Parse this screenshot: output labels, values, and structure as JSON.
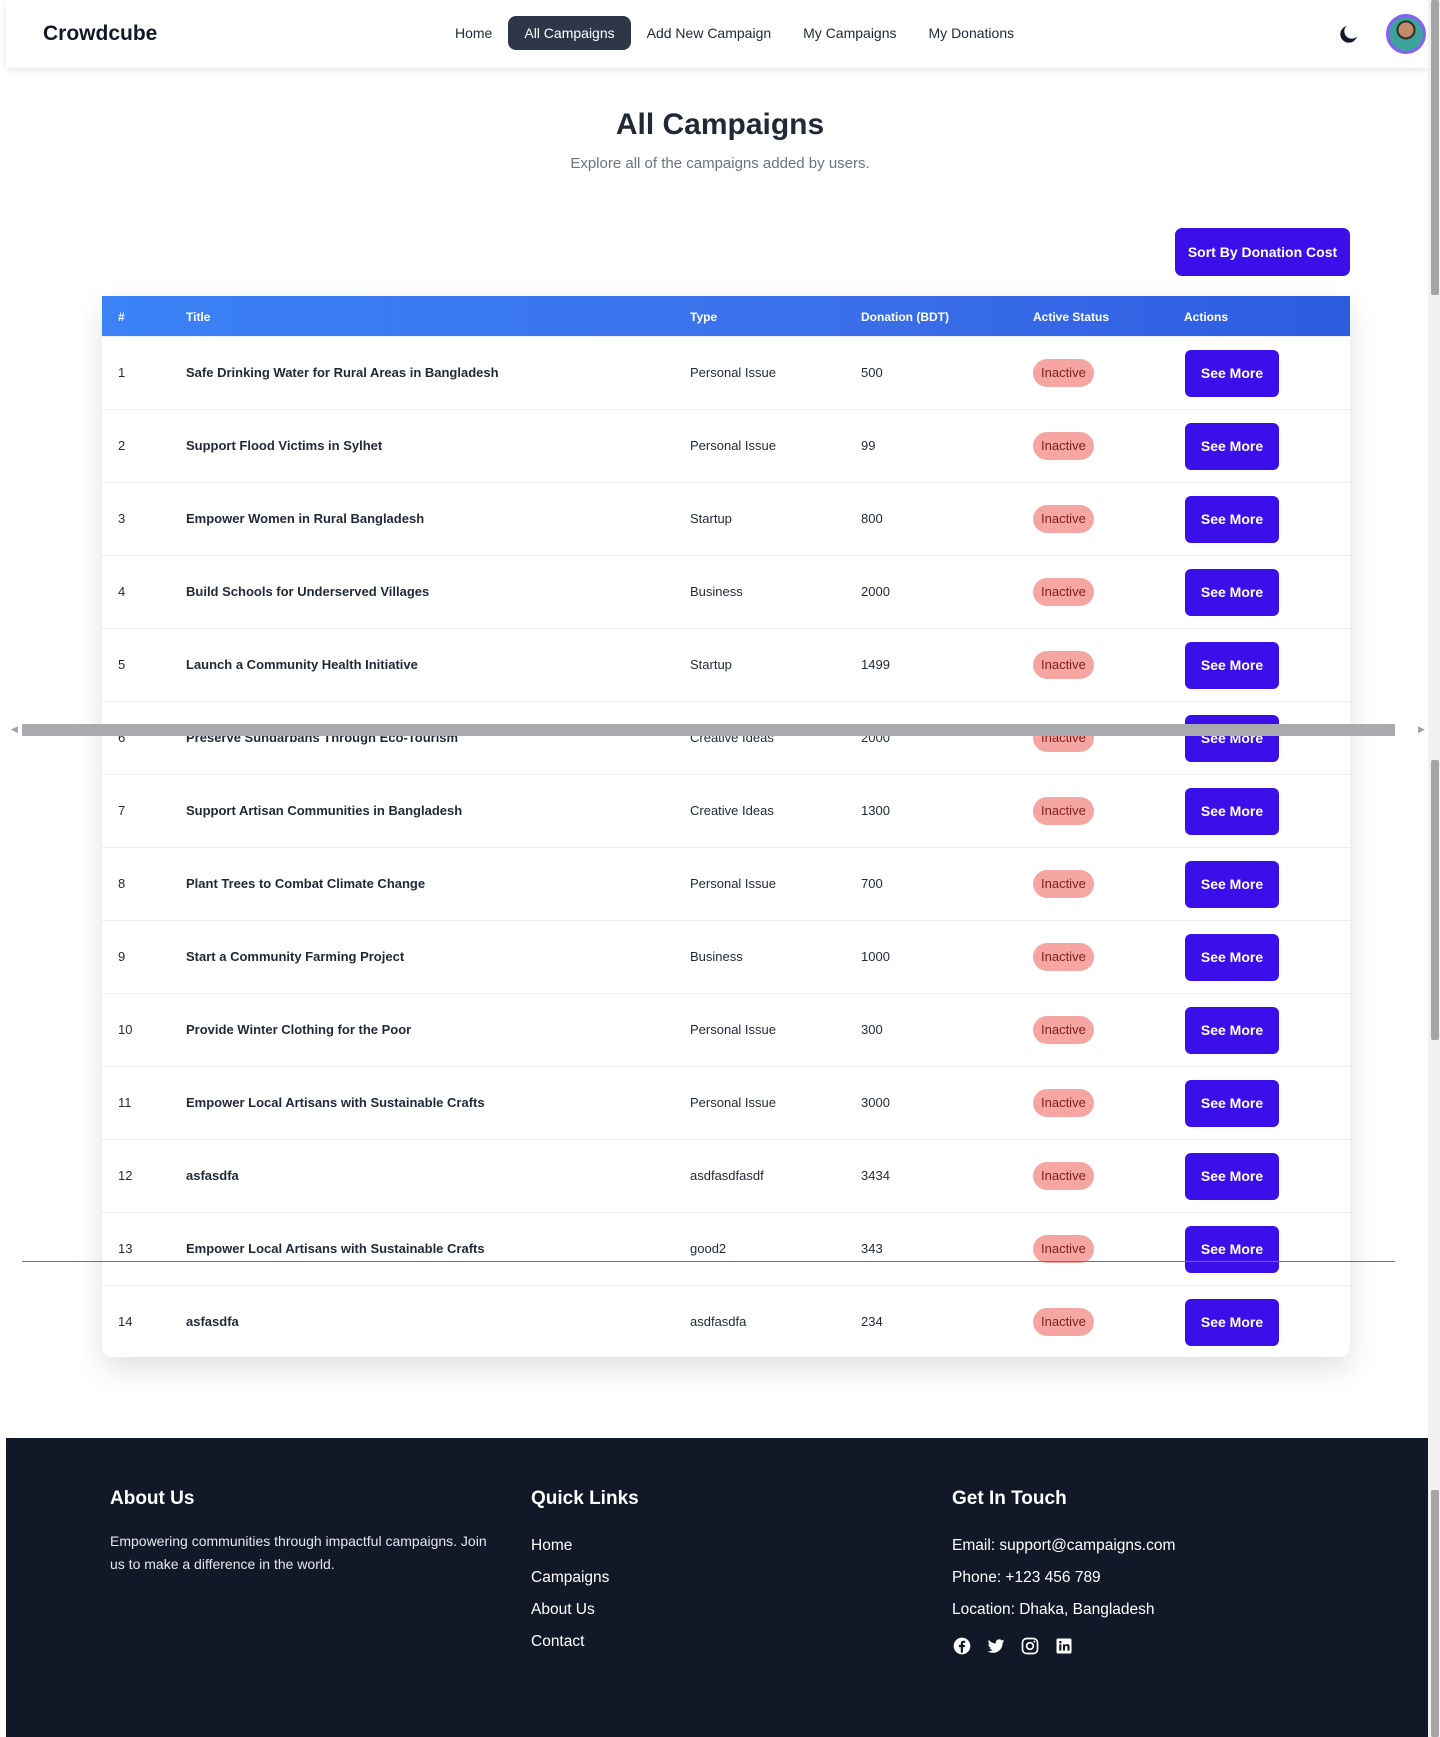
{
  "nav": {
    "brand": "Crowdcube",
    "links": [
      "Home",
      "All Campaigns",
      "Add New Campaign",
      "My Campaigns",
      "My Donations"
    ],
    "active": "All Campaigns",
    "theme_icon": "moon-icon",
    "avatar_icon": "user-avatar"
  },
  "hero": {
    "title": "All Campaigns",
    "subtitle": "Explore all of the campaigns added by users."
  },
  "sort_button": "Sort By Donation Cost",
  "table": {
    "headers": [
      "#",
      "Title",
      "Type",
      "Donation (BDT)",
      "Active Status",
      "Actions"
    ],
    "rows": [
      {
        "num": "1",
        "title": "Safe Drinking Water for Rural Areas in Bangladesh",
        "type": "Personal Issue",
        "donation": "500",
        "status": "Inactive",
        "action": "See More"
      },
      {
        "num": "2",
        "title": "Support Flood Victims in Sylhet",
        "type": "Personal Issue",
        "donation": "99",
        "status": "Inactive",
        "action": "See More"
      },
      {
        "num": "3",
        "title": "Empower Women in Rural Bangladesh",
        "type": "Startup",
        "donation": "800",
        "status": "Inactive",
        "action": "See More"
      },
      {
        "num": "4",
        "title": "Build Schools for Underserved Villages",
        "type": "Business",
        "donation": "2000",
        "status": "Inactive",
        "action": "See More"
      },
      {
        "num": "5",
        "title": "Launch a Community Health Initiative",
        "type": "Startup",
        "donation": "1499",
        "status": "Inactive",
        "action": "See More"
      },
      {
        "num": "6",
        "title": "Preserve Sundarbans Through Eco-Tourism",
        "type": "Creative Ideas",
        "donation": "2000",
        "status": "Inactive",
        "action": "See More"
      },
      {
        "num": "7",
        "title": "Support Artisan Communities in Bangladesh",
        "type": "Creative Ideas",
        "donation": "1300",
        "status": "Inactive",
        "action": "See More"
      },
      {
        "num": "8",
        "title": "Plant Trees to Combat Climate Change",
        "type": "Personal Issue",
        "donation": "700",
        "status": "Inactive",
        "action": "See More"
      },
      {
        "num": "9",
        "title": "Start a Community Farming Project",
        "type": "Business",
        "donation": "1000",
        "status": "Inactive",
        "action": "See More"
      },
      {
        "num": "10",
        "title": "Provide Winter Clothing for the Poor",
        "type": "Personal Issue",
        "donation": "300",
        "status": "Inactive",
        "action": "See More"
      },
      {
        "num": "11",
        "title": "Empower Local Artisans with Sustainable Crafts",
        "type": "Personal Issue",
        "donation": "3000",
        "status": "Inactive",
        "action": "See More"
      },
      {
        "num": "12",
        "title": "asfasdfa",
        "type": "asdfasdfasdf",
        "donation": "3434",
        "status": "Inactive",
        "action": "See More"
      },
      {
        "num": "13",
        "title": "Empower Local Artisans with Sustainable Crafts",
        "type": "good2",
        "donation": "343",
        "status": "Inactive",
        "action": "See More"
      },
      {
        "num": "14",
        "title": "asfasdfa",
        "type": "asdfasdfa",
        "donation": "234",
        "status": "Inactive",
        "action": "See More"
      }
    ]
  },
  "footer": {
    "about": {
      "heading": "About Us",
      "text": "Empowering communities through impactful campaigns. Join us to make a difference in the world."
    },
    "quick_links": {
      "heading": "Quick Links",
      "links": [
        "Home",
        "Campaigns",
        "About Us",
        "Contact"
      ]
    },
    "contact": {
      "heading": "Get In Touch",
      "email": "Email: support@campaigns.com",
      "phone": "Phone: +123 456 789",
      "location": "Location: Dhaka, Bangladesh",
      "socials": [
        "facebook-icon",
        "twitter-icon",
        "instagram-icon",
        "linkedin-icon"
      ]
    }
  },
  "colors": {
    "primary": "#3b0fea",
    "header_gradient_start": "#3b82f6",
    "header_gradient_end": "#2d5be0",
    "badge_bg": "#f5a6a3",
    "footer_bg": "#111827",
    "active_nav_bg": "#2d3748"
  }
}
